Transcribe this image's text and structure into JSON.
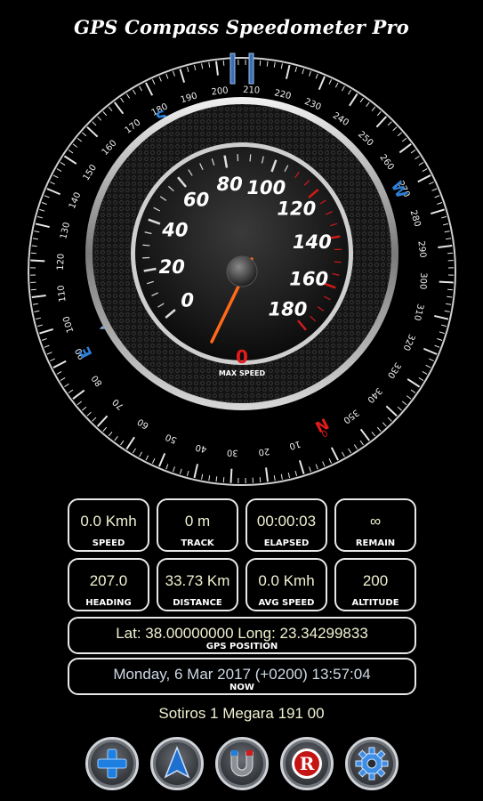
{
  "app": {
    "title": "GPS Compass Speedometer Pro"
  },
  "compass": {
    "heading_value": 207,
    "ticks": [
      "0",
      "10",
      "20",
      "30",
      "40",
      "50",
      "60",
      "70",
      "80",
      "90",
      "100",
      "110",
      "120",
      "130",
      "140",
      "150",
      "160",
      "170",
      "180",
      "190",
      "200",
      "210",
      "220",
      "230",
      "240",
      "250",
      "260",
      "270",
      "280",
      "290",
      "300",
      "310",
      "320",
      "330",
      "340",
      "350"
    ],
    "cardinals": {
      "n": "N",
      "e": "E",
      "s": "S",
      "w": "W"
    }
  },
  "speedometer": {
    "labels": [
      "0",
      "20",
      "40",
      "60",
      "80",
      "100",
      "120",
      "140",
      "160",
      "180"
    ],
    "speed_value": 0,
    "max_speed_value": "0",
    "max_speed_label": "MAX SPEED"
  },
  "stats": [
    {
      "value": "0.0 Kmh",
      "label": "SPEED"
    },
    {
      "value": "0 m",
      "label": "TRACK"
    },
    {
      "value": "00:00:03",
      "label": "ELAPSED"
    },
    {
      "value": "∞",
      "label": "REMAIN"
    },
    {
      "value": "207.0",
      "label": "HEADING"
    },
    {
      "value": "33.73 Km",
      "label": "DISTANCE"
    },
    {
      "value": "0.0 Kmh",
      "label": "AVG SPEED"
    },
    {
      "value": "200",
      "label": "ALTITUDE"
    }
  ],
  "gps": {
    "value": "Lat: 38.00000000  Long: 23.34299833",
    "label": "GPS  POSITION"
  },
  "now": {
    "value": "Monday, 6 Mar 2017 (+0200) 13:57:04",
    "label": "NOW"
  },
  "address": "Sotiros 1  Megara 191 00",
  "colors": {
    "accent_blue": "#2f7fd6",
    "needle": "#ff6a1a",
    "north_red": "#e41b1b",
    "speed_red": "#d11a1a"
  },
  "buttons": [
    {
      "icon": "plus-icon"
    },
    {
      "icon": "navigation-arrow-icon"
    },
    {
      "icon": "magnet-icon"
    },
    {
      "icon": "record-icon"
    },
    {
      "icon": "settings-gear-icon"
    }
  ]
}
